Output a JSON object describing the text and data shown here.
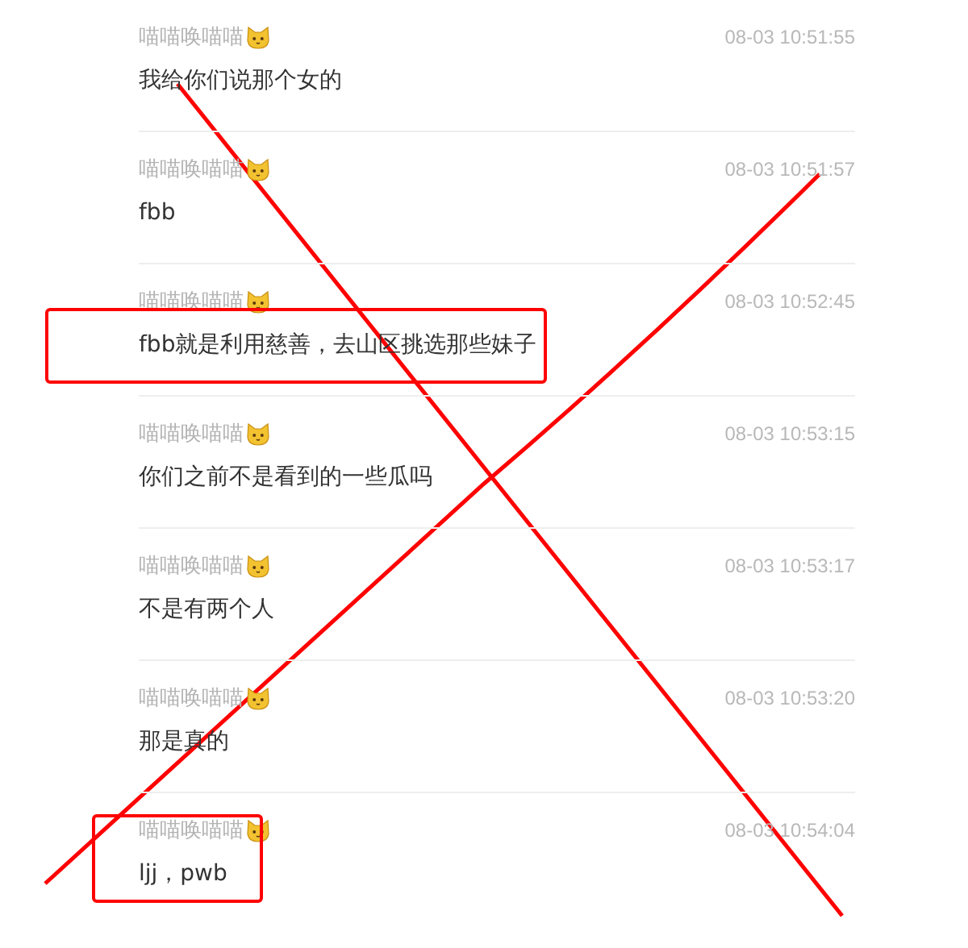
{
  "messages": [
    {
      "author": "喵喵唤喵喵",
      "time": "08-03 10:51:55",
      "text": "我给你们说那个女的",
      "highlighted": false
    },
    {
      "author": "喵喵唤喵喵",
      "time": "08-03 10:51:57",
      "text": "fbb",
      "highlighted": false
    },
    {
      "author": "喵喵唤喵喵",
      "time": "08-03 10:52:45",
      "text": "fbb就是利用慈善，去山区挑选那些妹子",
      "highlighted": true
    },
    {
      "author": "喵喵唤喵喵",
      "time": "08-03 10:53:15",
      "text": "你们之前不是看到的一些瓜吗",
      "highlighted": false
    },
    {
      "author": "喵喵唤喵喵",
      "time": "08-03 10:53:17",
      "text": "不是有两个人",
      "highlighted": false
    },
    {
      "author": "喵喵唤喵喵",
      "time": "08-03 10:53:20",
      "text": "那是真的",
      "highlighted": false
    },
    {
      "author": "喵喵唤喵喵",
      "time": "08-03 10:54:04",
      "text": "ljj，pwb",
      "highlighted": true
    }
  ]
}
